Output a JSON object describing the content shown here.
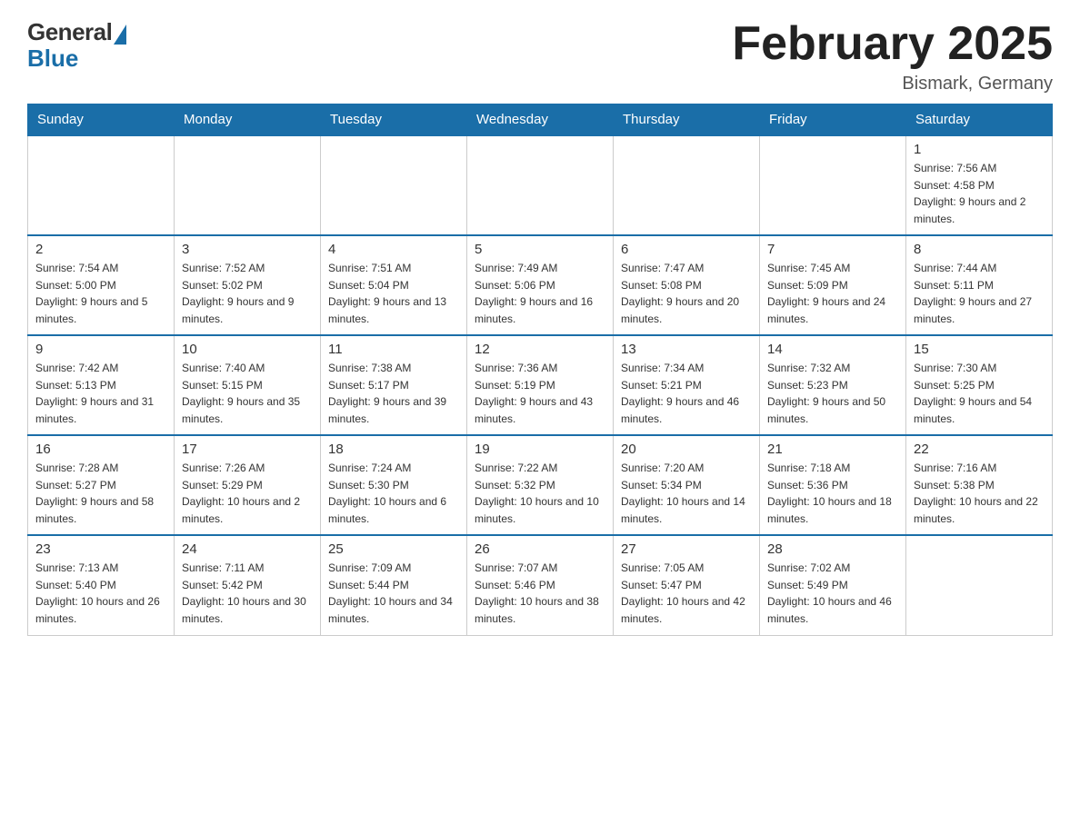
{
  "logo": {
    "general": "General",
    "blue": "Blue"
  },
  "header": {
    "title": "February 2025",
    "location": "Bismark, Germany"
  },
  "days_of_week": [
    "Sunday",
    "Monday",
    "Tuesday",
    "Wednesday",
    "Thursday",
    "Friday",
    "Saturday"
  ],
  "weeks": [
    [
      {
        "day": "",
        "info": ""
      },
      {
        "day": "",
        "info": ""
      },
      {
        "day": "",
        "info": ""
      },
      {
        "day": "",
        "info": ""
      },
      {
        "day": "",
        "info": ""
      },
      {
        "day": "",
        "info": ""
      },
      {
        "day": "1",
        "info": "Sunrise: 7:56 AM\nSunset: 4:58 PM\nDaylight: 9 hours and 2 minutes."
      }
    ],
    [
      {
        "day": "2",
        "info": "Sunrise: 7:54 AM\nSunset: 5:00 PM\nDaylight: 9 hours and 5 minutes."
      },
      {
        "day": "3",
        "info": "Sunrise: 7:52 AM\nSunset: 5:02 PM\nDaylight: 9 hours and 9 minutes."
      },
      {
        "day": "4",
        "info": "Sunrise: 7:51 AM\nSunset: 5:04 PM\nDaylight: 9 hours and 13 minutes."
      },
      {
        "day": "5",
        "info": "Sunrise: 7:49 AM\nSunset: 5:06 PM\nDaylight: 9 hours and 16 minutes."
      },
      {
        "day": "6",
        "info": "Sunrise: 7:47 AM\nSunset: 5:08 PM\nDaylight: 9 hours and 20 minutes."
      },
      {
        "day": "7",
        "info": "Sunrise: 7:45 AM\nSunset: 5:09 PM\nDaylight: 9 hours and 24 minutes."
      },
      {
        "day": "8",
        "info": "Sunrise: 7:44 AM\nSunset: 5:11 PM\nDaylight: 9 hours and 27 minutes."
      }
    ],
    [
      {
        "day": "9",
        "info": "Sunrise: 7:42 AM\nSunset: 5:13 PM\nDaylight: 9 hours and 31 minutes."
      },
      {
        "day": "10",
        "info": "Sunrise: 7:40 AM\nSunset: 5:15 PM\nDaylight: 9 hours and 35 minutes."
      },
      {
        "day": "11",
        "info": "Sunrise: 7:38 AM\nSunset: 5:17 PM\nDaylight: 9 hours and 39 minutes."
      },
      {
        "day": "12",
        "info": "Sunrise: 7:36 AM\nSunset: 5:19 PM\nDaylight: 9 hours and 43 minutes."
      },
      {
        "day": "13",
        "info": "Sunrise: 7:34 AM\nSunset: 5:21 PM\nDaylight: 9 hours and 46 minutes."
      },
      {
        "day": "14",
        "info": "Sunrise: 7:32 AM\nSunset: 5:23 PM\nDaylight: 9 hours and 50 minutes."
      },
      {
        "day": "15",
        "info": "Sunrise: 7:30 AM\nSunset: 5:25 PM\nDaylight: 9 hours and 54 minutes."
      }
    ],
    [
      {
        "day": "16",
        "info": "Sunrise: 7:28 AM\nSunset: 5:27 PM\nDaylight: 9 hours and 58 minutes."
      },
      {
        "day": "17",
        "info": "Sunrise: 7:26 AM\nSunset: 5:29 PM\nDaylight: 10 hours and 2 minutes."
      },
      {
        "day": "18",
        "info": "Sunrise: 7:24 AM\nSunset: 5:30 PM\nDaylight: 10 hours and 6 minutes."
      },
      {
        "day": "19",
        "info": "Sunrise: 7:22 AM\nSunset: 5:32 PM\nDaylight: 10 hours and 10 minutes."
      },
      {
        "day": "20",
        "info": "Sunrise: 7:20 AM\nSunset: 5:34 PM\nDaylight: 10 hours and 14 minutes."
      },
      {
        "day": "21",
        "info": "Sunrise: 7:18 AM\nSunset: 5:36 PM\nDaylight: 10 hours and 18 minutes."
      },
      {
        "day": "22",
        "info": "Sunrise: 7:16 AM\nSunset: 5:38 PM\nDaylight: 10 hours and 22 minutes."
      }
    ],
    [
      {
        "day": "23",
        "info": "Sunrise: 7:13 AM\nSunset: 5:40 PM\nDaylight: 10 hours and 26 minutes."
      },
      {
        "day": "24",
        "info": "Sunrise: 7:11 AM\nSunset: 5:42 PM\nDaylight: 10 hours and 30 minutes."
      },
      {
        "day": "25",
        "info": "Sunrise: 7:09 AM\nSunset: 5:44 PM\nDaylight: 10 hours and 34 minutes."
      },
      {
        "day": "26",
        "info": "Sunrise: 7:07 AM\nSunset: 5:46 PM\nDaylight: 10 hours and 38 minutes."
      },
      {
        "day": "27",
        "info": "Sunrise: 7:05 AM\nSunset: 5:47 PM\nDaylight: 10 hours and 42 minutes."
      },
      {
        "day": "28",
        "info": "Sunrise: 7:02 AM\nSunset: 5:49 PM\nDaylight: 10 hours and 46 minutes."
      },
      {
        "day": "",
        "info": ""
      }
    ]
  ],
  "colors": {
    "header_bg": "#1a6ea8",
    "header_text": "#ffffff",
    "border": "#cccccc",
    "text": "#333333"
  }
}
